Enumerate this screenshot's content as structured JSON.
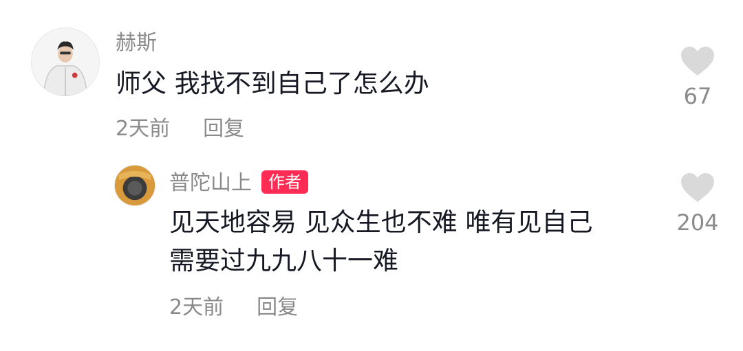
{
  "comments": [
    {
      "author": "赫斯",
      "text": "师父 我找不到自己了怎么办",
      "time": "2天前",
      "reply_label": "回复",
      "likes": "67",
      "avatar_icon": "avatar-man-white-jacket"
    }
  ],
  "replies": [
    {
      "author": "普陀山上",
      "author_badge": "作者",
      "text_line1": "见天地容易 见众生也不难 唯有见自己",
      "text_line2": "需要过九九八十一难",
      "time": "2天前",
      "reply_label": "回复",
      "likes": "204",
      "avatar_icon": "avatar-orange-round"
    }
  ],
  "colors": {
    "badge": "#fe2c55",
    "meta": "#8a8a8a",
    "text": "#161823",
    "heart": "#d9d9d9"
  },
  "icons": {
    "like": "heart-icon"
  }
}
